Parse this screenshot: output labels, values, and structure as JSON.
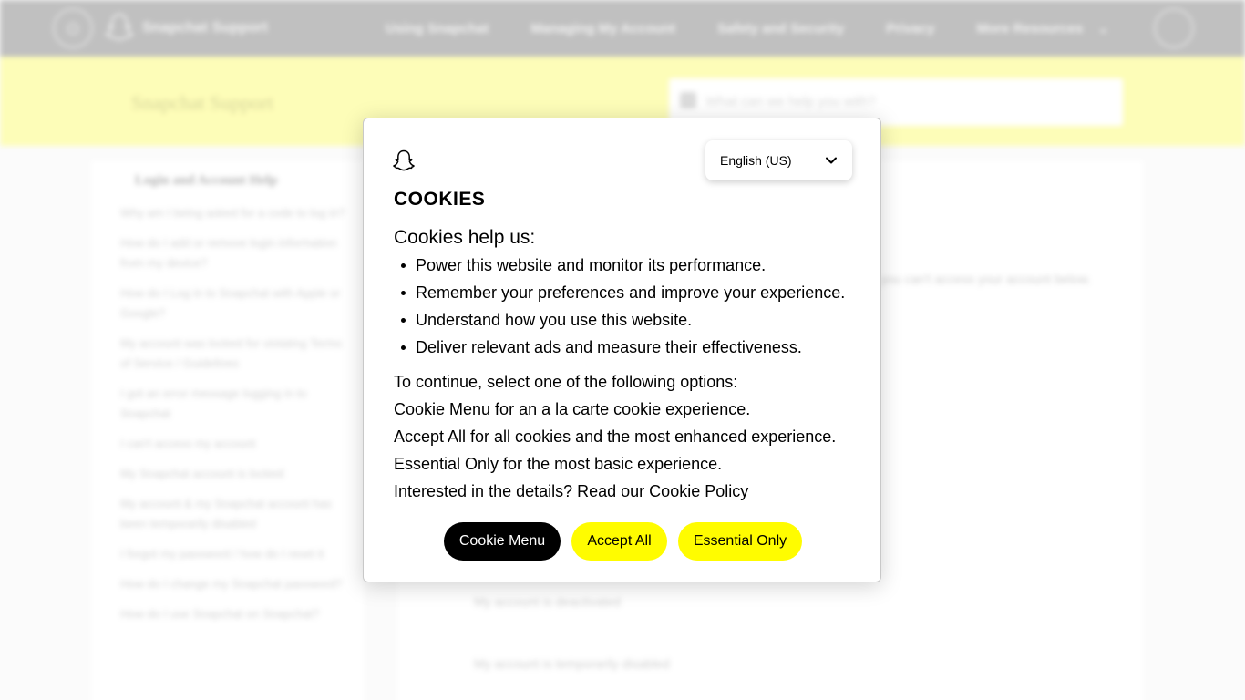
{
  "background_page": {
    "nav": {
      "brand": "Snapchat Support",
      "links": [
        "Using Snapchat",
        "Managing My Account",
        "Safety and Security",
        "Privacy",
        "More Resources"
      ]
    },
    "banner": {
      "title": "Snapchat Support",
      "search_placeholder": "What can we help you with?"
    },
    "sidebar": {
      "heading": "Login and Account Help",
      "items": [
        "Why am I being asked for a code to log in?",
        "How do I add or remove login information from my device?",
        "How do I Log in to Snapchat with Apple or Google?",
        "My account was locked for violating Terms of Service / Guidelines",
        "I got an error message logging in to Snapchat",
        "I can't access my account",
        "My Snapchat account is locked",
        "My account & my Snapchat account has been temporarily disabled",
        "I forgot my password / how do I reset it",
        "How do I change my Snapchat password?",
        "How do I use Snapchat on Snapchat?"
      ]
    },
    "main": {
      "line1": "you can't access your account below.",
      "line2": "My account is deactivated",
      "line3": "My account is temporarily disabled"
    }
  },
  "cookie_modal": {
    "logo_icon": "snapchat-ghost-icon",
    "language": "English (US)",
    "title": "COOKIES",
    "intro": "Cookies help us:",
    "bullets": [
      "Power this website and monitor its performance.",
      "Remember your preferences and improve your experience.",
      "Understand how you use this website.",
      "Deliver relevant ads and measure their effectiveness."
    ],
    "lines": [
      "To continue, select one of the following options:",
      "Cookie Menu for an a la carte cookie experience.",
      "Accept All for all cookies and the most enhanced experience.",
      "Essential Only for the most basic experience.",
      "Interested in the details? Read our Cookie Policy"
    ],
    "buttons": {
      "menu": "Cookie Menu",
      "accept": "Accept All",
      "essential": "Essential Only"
    },
    "colors": {
      "accent_yellow": "#fffc00",
      "dark_button": "#000000"
    }
  }
}
